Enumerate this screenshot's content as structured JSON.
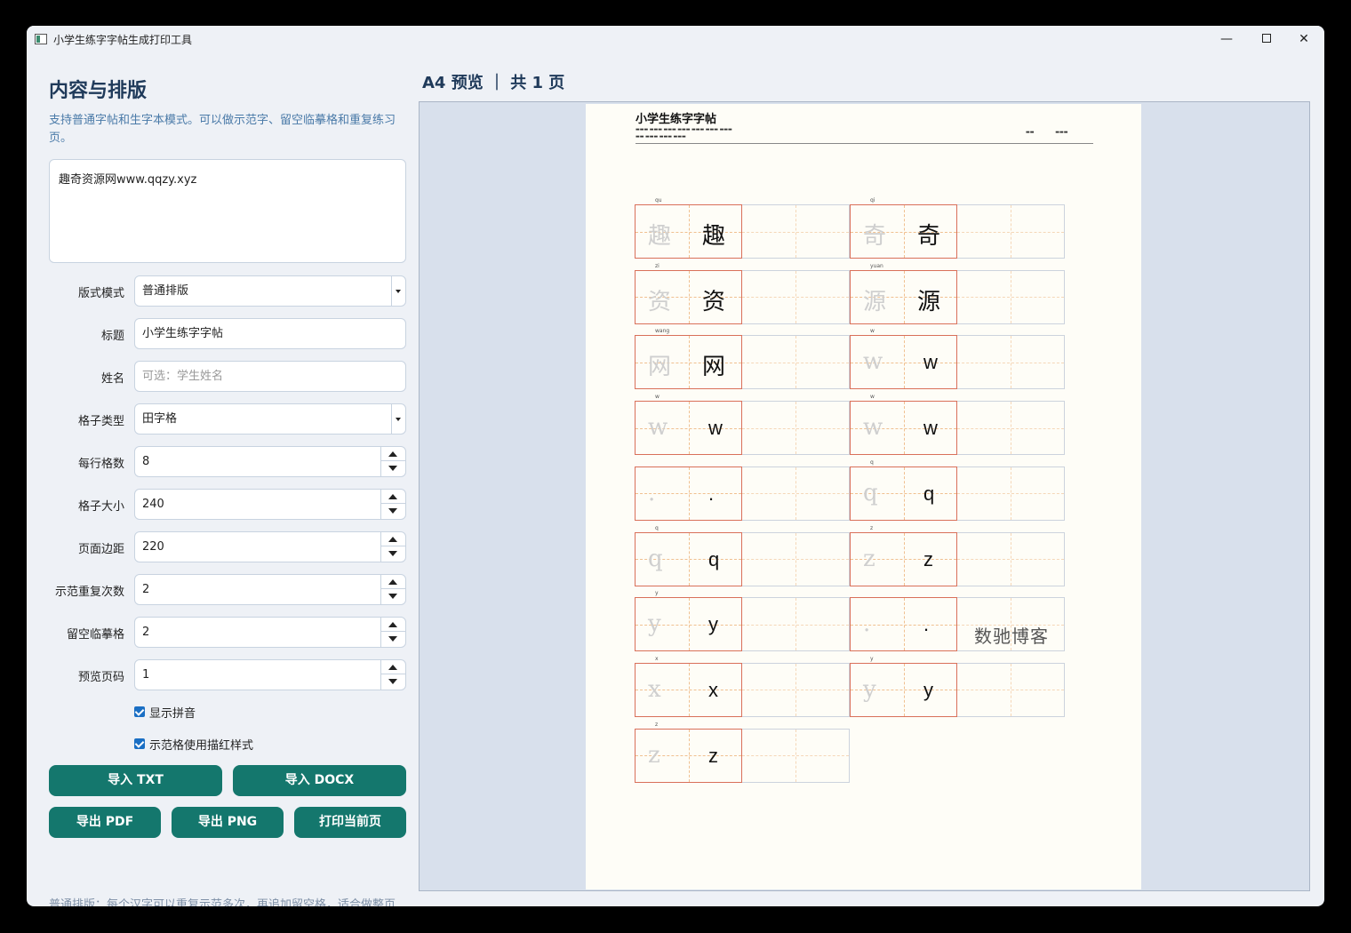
{
  "window": {
    "title": "小学生练字字帖生成打印工具"
  },
  "sidebar": {
    "heading": "内容与排版",
    "description": "支持普通字帖和生字本模式。可以做示范字、留空临摹格和重复练习页。",
    "content_text": "趣奇资源网www.qqzy.xyz",
    "layout_mode": {
      "label": "版式模式",
      "value": "普通排版"
    },
    "title": {
      "label": "标题",
      "value": "小学生练字字帖"
    },
    "name": {
      "label": "姓名",
      "value": "",
      "placeholder": "可选：学生姓名"
    },
    "grid_type": {
      "label": "格子类型",
      "value": "田字格"
    },
    "cells_per_row": {
      "label": "每行格数",
      "value": "8"
    },
    "cell_size": {
      "label": "格子大小",
      "value": "240"
    },
    "page_margin": {
      "label": "页面边距",
      "value": "220"
    },
    "demo_repeat": {
      "label": "示范重复次数",
      "value": "2"
    },
    "blank_cells": {
      "label": "留空临摹格",
      "value": "2"
    },
    "preview_page": {
      "label": "预览页码",
      "value": "1"
    },
    "show_pinyin": {
      "label": "显示拼音",
      "checked": true
    },
    "trace_red": {
      "label": "示范格使用描红样式",
      "checked": true
    },
    "buttons": {
      "import_txt": "导入 TXT",
      "import_docx": "导入 DOCX",
      "export_pdf": "导出 PDF",
      "export_png": "导出 PNG",
      "print_page": "打印当前页"
    },
    "footnote": "普通排版：每个汉字可以重复示范多次，再追加留空格，适合做整页字帖。"
  },
  "preview": {
    "header": "A4 预览 ｜ 共 1 页",
    "paper_title": "小学生练字字帖",
    "watermark": "数驰博客",
    "left_column": [
      {
        "char": "趣",
        "pinyin": "qu",
        "latin": false
      },
      {
        "char": "资",
        "pinyin": "zi",
        "latin": false
      },
      {
        "char": "网",
        "pinyin": "wang",
        "latin": false
      },
      {
        "char": "w",
        "pinyin": "w",
        "latin": true
      },
      {
        "char": ".",
        "pinyin": "",
        "latin": true
      },
      {
        "char": "q",
        "pinyin": "q",
        "latin": true
      },
      {
        "char": "y",
        "pinyin": "y",
        "latin": true
      },
      {
        "char": "x",
        "pinyin": "x",
        "latin": true
      },
      {
        "char": "z",
        "pinyin": "z",
        "latin": true
      }
    ],
    "right_column": [
      {
        "char": "奇",
        "pinyin": "qi",
        "latin": false
      },
      {
        "char": "源",
        "pinyin": "yuan",
        "latin": false
      },
      {
        "char": "w",
        "pinyin": "w",
        "latin": true
      },
      {
        "char": "w",
        "pinyin": "w",
        "latin": true
      },
      {
        "char": "q",
        "pinyin": "q",
        "latin": true
      },
      {
        "char": "z",
        "pinyin": "z",
        "latin": true
      },
      {
        "char": ".",
        "pinyin": "",
        "latin": true
      },
      {
        "char": "y",
        "pinyin": "y",
        "latin": true
      }
    ]
  }
}
